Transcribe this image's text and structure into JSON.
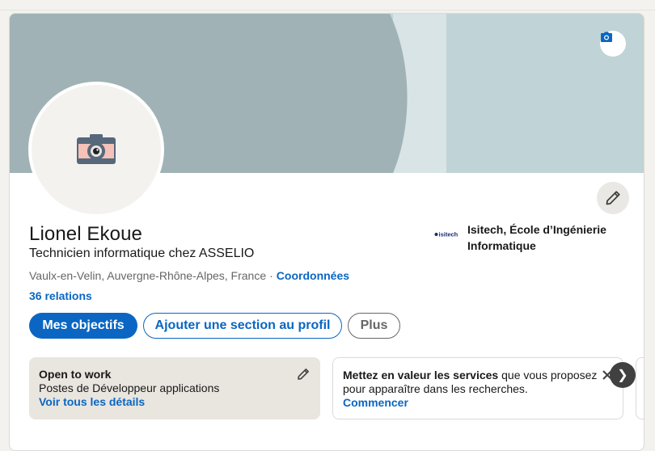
{
  "profile": {
    "name": "Lionel Ekoue",
    "headline": "Technicien informatique chez ASSELIO",
    "location": "Vaulx-en-Velin, Auvergne-Rhône-Alpes, France",
    "separator": "·",
    "contact_link": "Coordonnées",
    "relations": "36 relations"
  },
  "school": {
    "logo_text": "isitech",
    "name": "Isitech, École d’Ingénierie Informatique"
  },
  "actions": {
    "primary": "Mes objectifs",
    "add_section": "Ajouter une section au profil",
    "more": "Plus"
  },
  "open_to_work": {
    "title": "Open to work",
    "subtitle": "Postes de Développeur applications",
    "link": "Voir tous les détails"
  },
  "services": {
    "strong": "Mettez en valeur les services",
    "text": " que vous proposez pour apparaître dans les recherches.",
    "link": "Commencer"
  },
  "icons": {
    "banner_camera": "camera-icon",
    "avatar_placeholder": "camera-placeholder-icon",
    "edit": "pencil-icon",
    "close": "close-icon",
    "next": "chevron-right-icon"
  },
  "colors": {
    "accent": "#0a66c2",
    "banner": "#c0d3d6",
    "open_to_work_bg": "#e9e5df"
  },
  "next_glyph": "❯"
}
